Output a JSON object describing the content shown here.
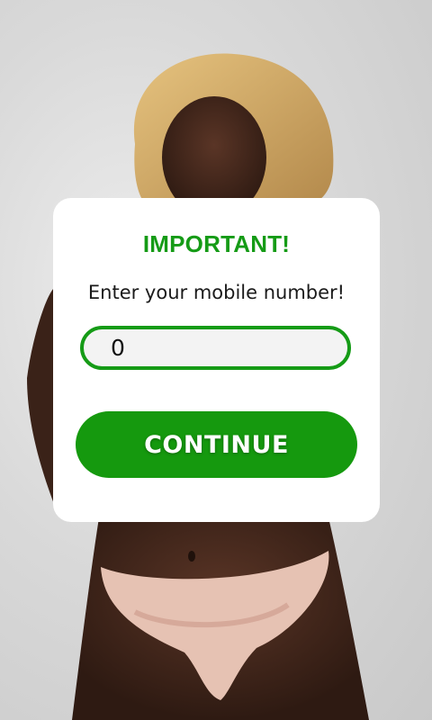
{
  "background": {
    "image": "model-photo"
  },
  "modal": {
    "title": "IMPORTANT!",
    "prompt": "Enter your mobile number!",
    "phone_value": "0",
    "continue_label": "CONTINUE"
  },
  "colors": {
    "accent_green": "#159b16",
    "modal_background": "#ffffff",
    "input_background": "#f3f3f3"
  }
}
